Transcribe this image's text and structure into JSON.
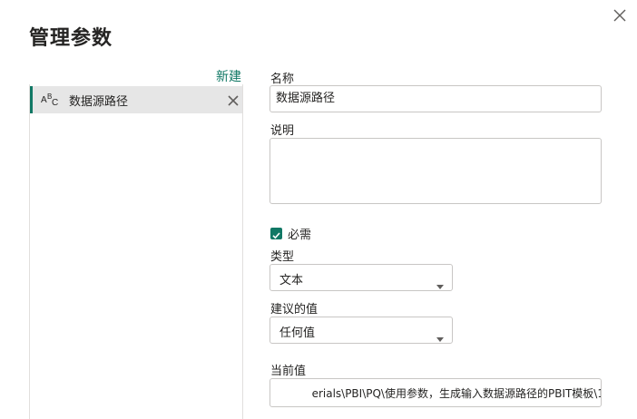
{
  "dialog": {
    "title": "管理参数",
    "close_icon": "close-icon"
  },
  "sidebar": {
    "new_label": "新建",
    "items": [
      {
        "icon": "text-type-icon",
        "name": "数据源路径",
        "remove_icon": "close-icon"
      }
    ]
  },
  "form": {
    "name_label": "名称",
    "name_value": "数据源路径",
    "description_label": "说明",
    "description_value": "",
    "required_label": "必需",
    "required_checked": true,
    "type_label": "类型",
    "type_value": "文本",
    "suggested_label": "建议的值",
    "suggested_value": "任何值",
    "current_label": "当前值",
    "current_value": "erials\\PBI\\PQ\\使用参数，生成输入数据源路径的PBIT模板\\1"
  },
  "colors": {
    "accent": "#117865",
    "selected_bg": "#e6e6e6",
    "border": "#c8c6c4"
  }
}
